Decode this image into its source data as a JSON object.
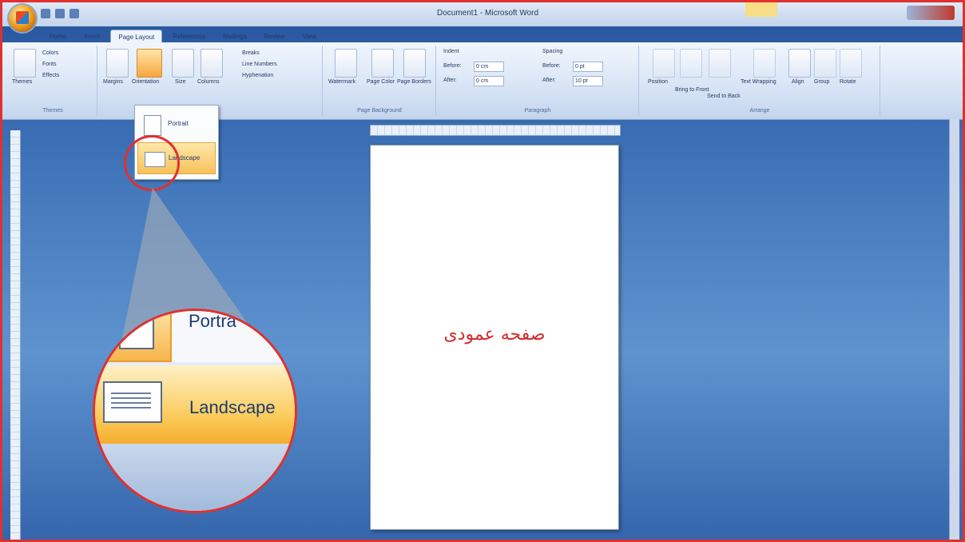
{
  "window": {
    "title": "Document1 - Microsoft Word"
  },
  "ribbon": {
    "tabs": [
      "Home",
      "Insert",
      "Page Layout",
      "References",
      "Mailings",
      "Review",
      "View"
    ],
    "active_tab": "Page Layout",
    "themes": {
      "themes": "Themes",
      "colors": "Colors",
      "fonts": "Fonts",
      "effects": "Effects",
      "group": "Themes"
    },
    "page_setup": {
      "margins": "Margins",
      "orientation": "Orientation",
      "size": "Size",
      "columns": "Columns",
      "breaks": "Breaks",
      "line_numbers": "Line Numbers",
      "hyphenation": "Hyphenation"
    },
    "page_background": {
      "watermark": "Watermark",
      "page_color": "Page Color",
      "page_borders": "Page Borders",
      "group": "Page Background"
    },
    "paragraph": {
      "indent": "Indent",
      "spacing": "Spacing",
      "before": "Before:",
      "after": "After:",
      "indent_before": "0 cm",
      "indent_after": "0 cm",
      "spacing_before": "0 pt",
      "spacing_after": "10 pt",
      "group": "Paragraph"
    },
    "arrange": {
      "position": "Position",
      "bring_to_front": "Bring to Front",
      "send_to_back": "Send to Back",
      "text_wrapping": "Text Wrapping",
      "align": "Align",
      "group_btn": "Group",
      "rotate": "Rotate",
      "group": "Arrange"
    }
  },
  "orientation_menu": {
    "portrait": "Portrait",
    "landscape": "Landscape"
  },
  "magnified": {
    "portrait": "Portra",
    "landscape": "Landscape"
  },
  "page": {
    "caption": "صفحه عمودی"
  },
  "colors": {
    "highlight": "#e0312f",
    "accent": "#f6a640"
  }
}
